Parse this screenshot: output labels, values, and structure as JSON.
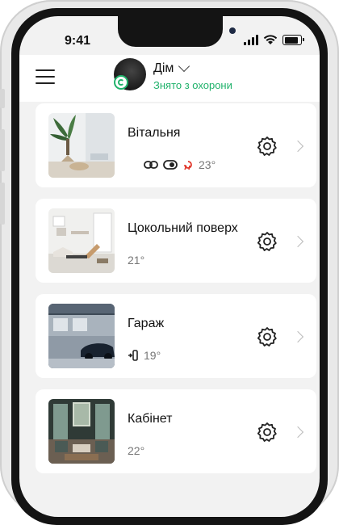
{
  "status_bar": {
    "time": "9:41"
  },
  "header": {
    "hub_name": "Дім",
    "hub_mode": "Знято з охорони",
    "accent": "#20b26b"
  },
  "rooms": [
    {
      "name": "Вітальня",
      "temperature": "23°",
      "icons": [
        "link-icon",
        "toggle-icon",
        "smoke-icon"
      ]
    },
    {
      "name": "Цокольний поверх",
      "temperature": "21°"
    },
    {
      "name": "Гараж",
      "temperature": "19°",
      "icons": [
        "door-sensor-icon"
      ]
    },
    {
      "name": "Кабінет",
      "temperature": "22°"
    }
  ]
}
